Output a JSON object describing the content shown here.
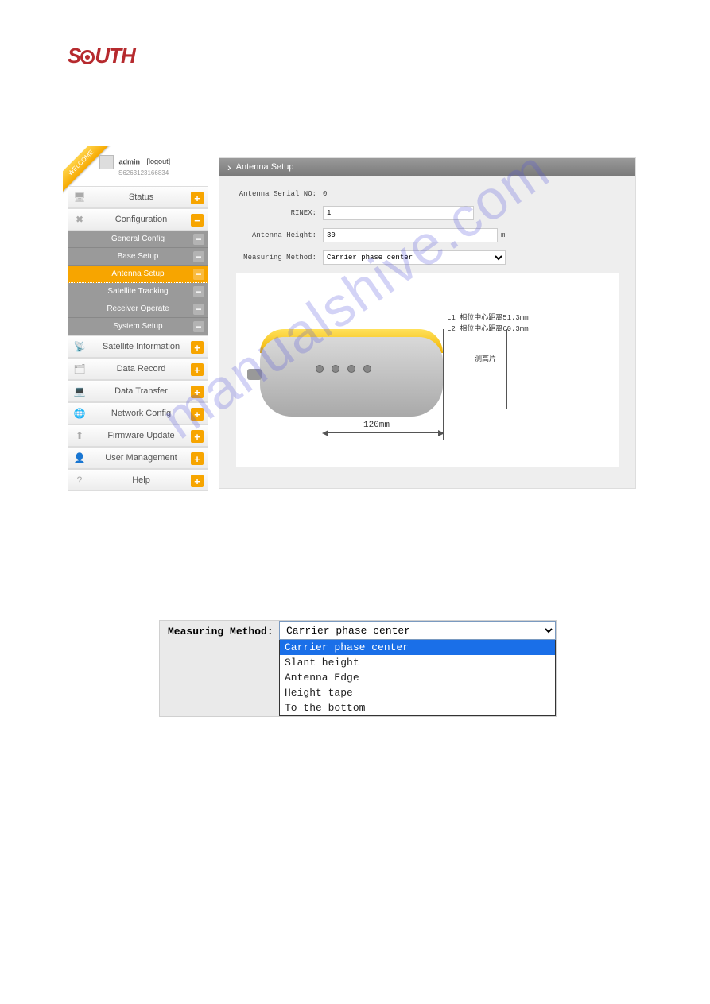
{
  "brand": "SOUTH",
  "welcome_ribbon": "WELCOME",
  "user": {
    "name": "admin",
    "serial": "S6263123166834",
    "logout": "[logout]"
  },
  "content_header": "Antenna Setup",
  "form": {
    "antenna_serial_label": "Antenna Serial NO:",
    "antenna_serial_value": "0",
    "rinex_label": "RINEX:",
    "rinex_value": "1",
    "antenna_height_label": "Antenna Height:",
    "antenna_height_value": "30",
    "antenna_height_unit": "m",
    "measuring_method_label": "Measuring Method:",
    "measuring_method_value": "Carrier phase center"
  },
  "diagram": {
    "l1": "L1 相位中心距离51.3mm",
    "l2": "L2 相位中心距离60.3mm",
    "tab": "测高片",
    "dim": "120mm"
  },
  "sidebar": {
    "items": [
      {
        "icon": "🖥",
        "label": "Status"
      },
      {
        "icon": "✖",
        "label": "Configuration"
      },
      {
        "icon": "📡",
        "label": "Satellite Information"
      },
      {
        "icon": "🗂",
        "label": "Data Record"
      },
      {
        "icon": "💻",
        "label": "Data Transfer"
      },
      {
        "icon": "🌐",
        "label": "Network Config"
      },
      {
        "icon": "⬆",
        "label": "Firmware Update"
      },
      {
        "icon": "👤",
        "label": "User Management"
      },
      {
        "icon": "?",
        "label": "Help"
      }
    ],
    "subitems": [
      "General Config",
      "Base Setup",
      "Antenna Setup",
      "Satellite Tracking",
      "Receiver Operate",
      "System Setup"
    ]
  },
  "detail": {
    "label": "Measuring Method:",
    "selected": "Carrier phase center",
    "options": [
      "Carrier phase center",
      "Slant height",
      "Antenna Edge",
      "Height tape",
      "To the bottom"
    ]
  },
  "watermark": "manualshive.com"
}
